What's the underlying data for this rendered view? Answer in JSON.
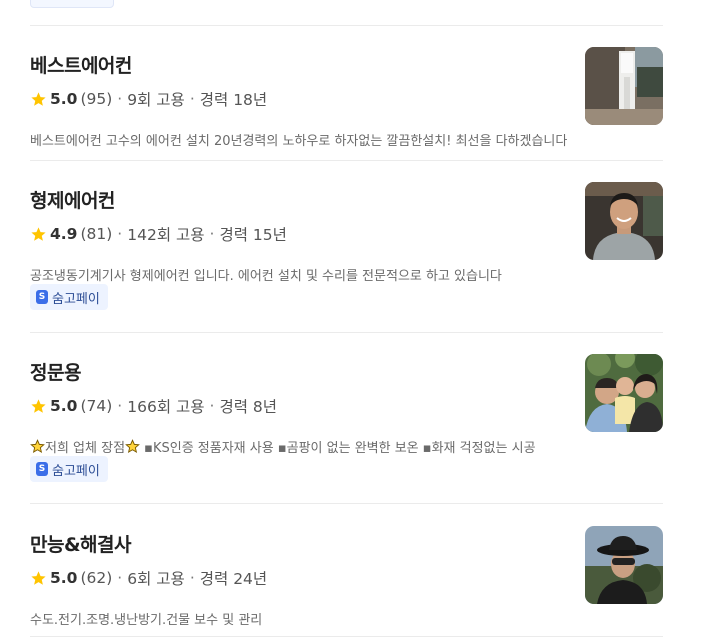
{
  "pros": [
    {
      "name": "베스트에어컨",
      "rating": "5.0",
      "reviews": "(95)",
      "hires": "9회 고용",
      "career": "경력 18년",
      "description": "베스트에어컨 고수의 에어컨 설치 20년경력의 노하우로 하자없는 깔끔한설치! 최선을 다하겠습니다",
      "pay_badge": ""
    },
    {
      "name": "형제에어컨",
      "rating": "4.9",
      "reviews": "(81)",
      "hires": "142회 고용",
      "career": "경력 15년",
      "description": "공조냉동기계기사 형제에어컨 입니다. 에어컨 설치 및 수리를 전문적으로 하고 있습니다",
      "pay_badge": "숨고페이"
    },
    {
      "name": "정문용",
      "rating": "5.0",
      "reviews": "(74)",
      "hires": "166회 고용",
      "career": "경력 8년",
      "description_main": "저희 업체 장점",
      "description_rest": " ▪KS인증 정품자재 사용 ▪곰팡이 없는 완벽한 보온 ▪화재 걱정없는 시공",
      "pay_badge": "숨고페이"
    },
    {
      "name": "만능&해결사",
      "rating": "5.0",
      "reviews": "(62)",
      "hires": "6회 고용",
      "career": "경력 24년",
      "description": "수도.전기.조명.냉난방기.건물 보수 및 관리",
      "pay_badge": ""
    }
  ],
  "separator": "·",
  "colors": {
    "star": "#ffc400",
    "pay_bg": "#edf3ff",
    "pay_icon": "#3b6ee8"
  }
}
